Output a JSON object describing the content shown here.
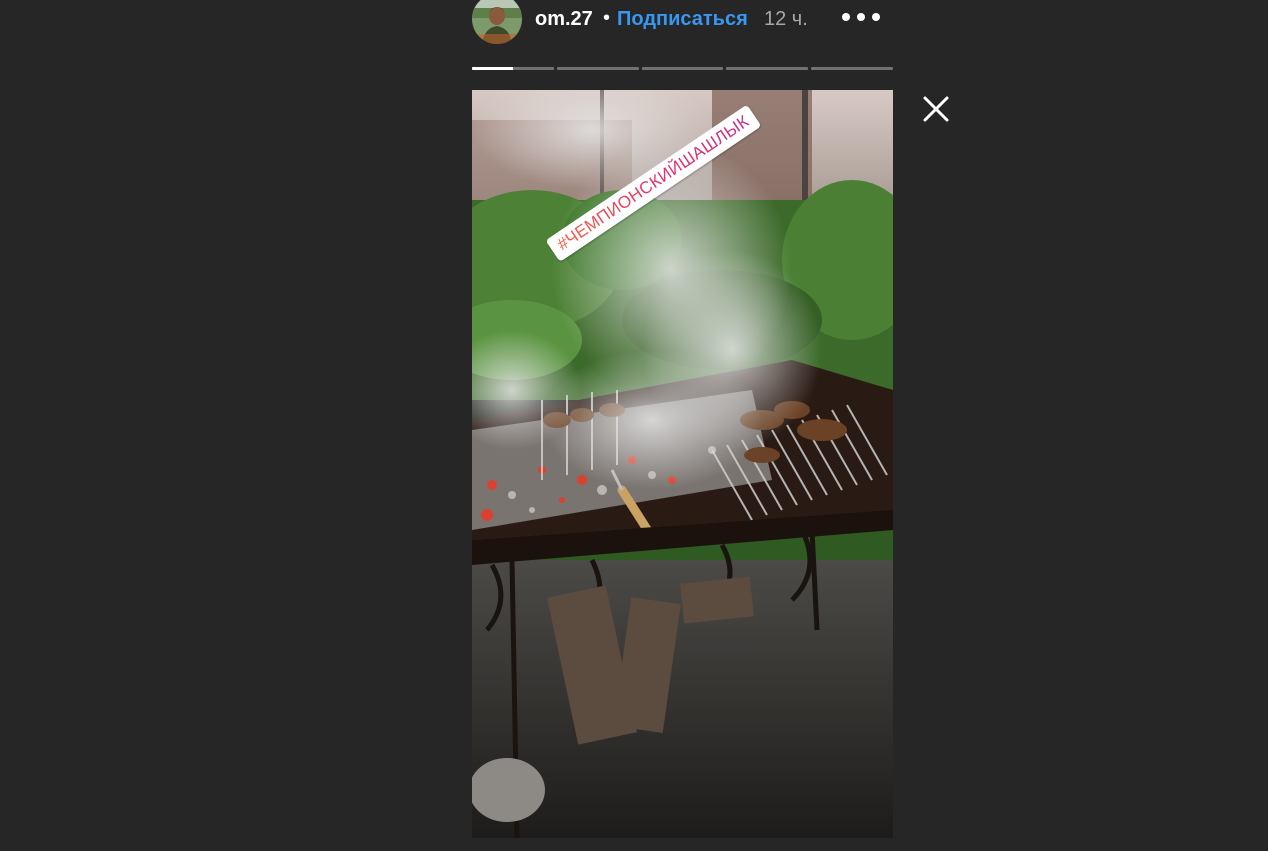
{
  "header": {
    "username": "om.27",
    "separator": "•",
    "follow_label": "Подписаться",
    "time_ago": "12 ч."
  },
  "progress": {
    "segments": 5,
    "active_index": 0,
    "active_fraction": 0.5
  },
  "sticker": {
    "hashtag": "#ЧЕМПИОНСКИЙШАШЛЫК"
  },
  "colors": {
    "background": "#262626",
    "accent": "#3897f0",
    "text": "#ffffff",
    "muted": "#a8a8a8"
  },
  "icons": {
    "more": "more-horizontal-icon",
    "close": "close-icon"
  }
}
